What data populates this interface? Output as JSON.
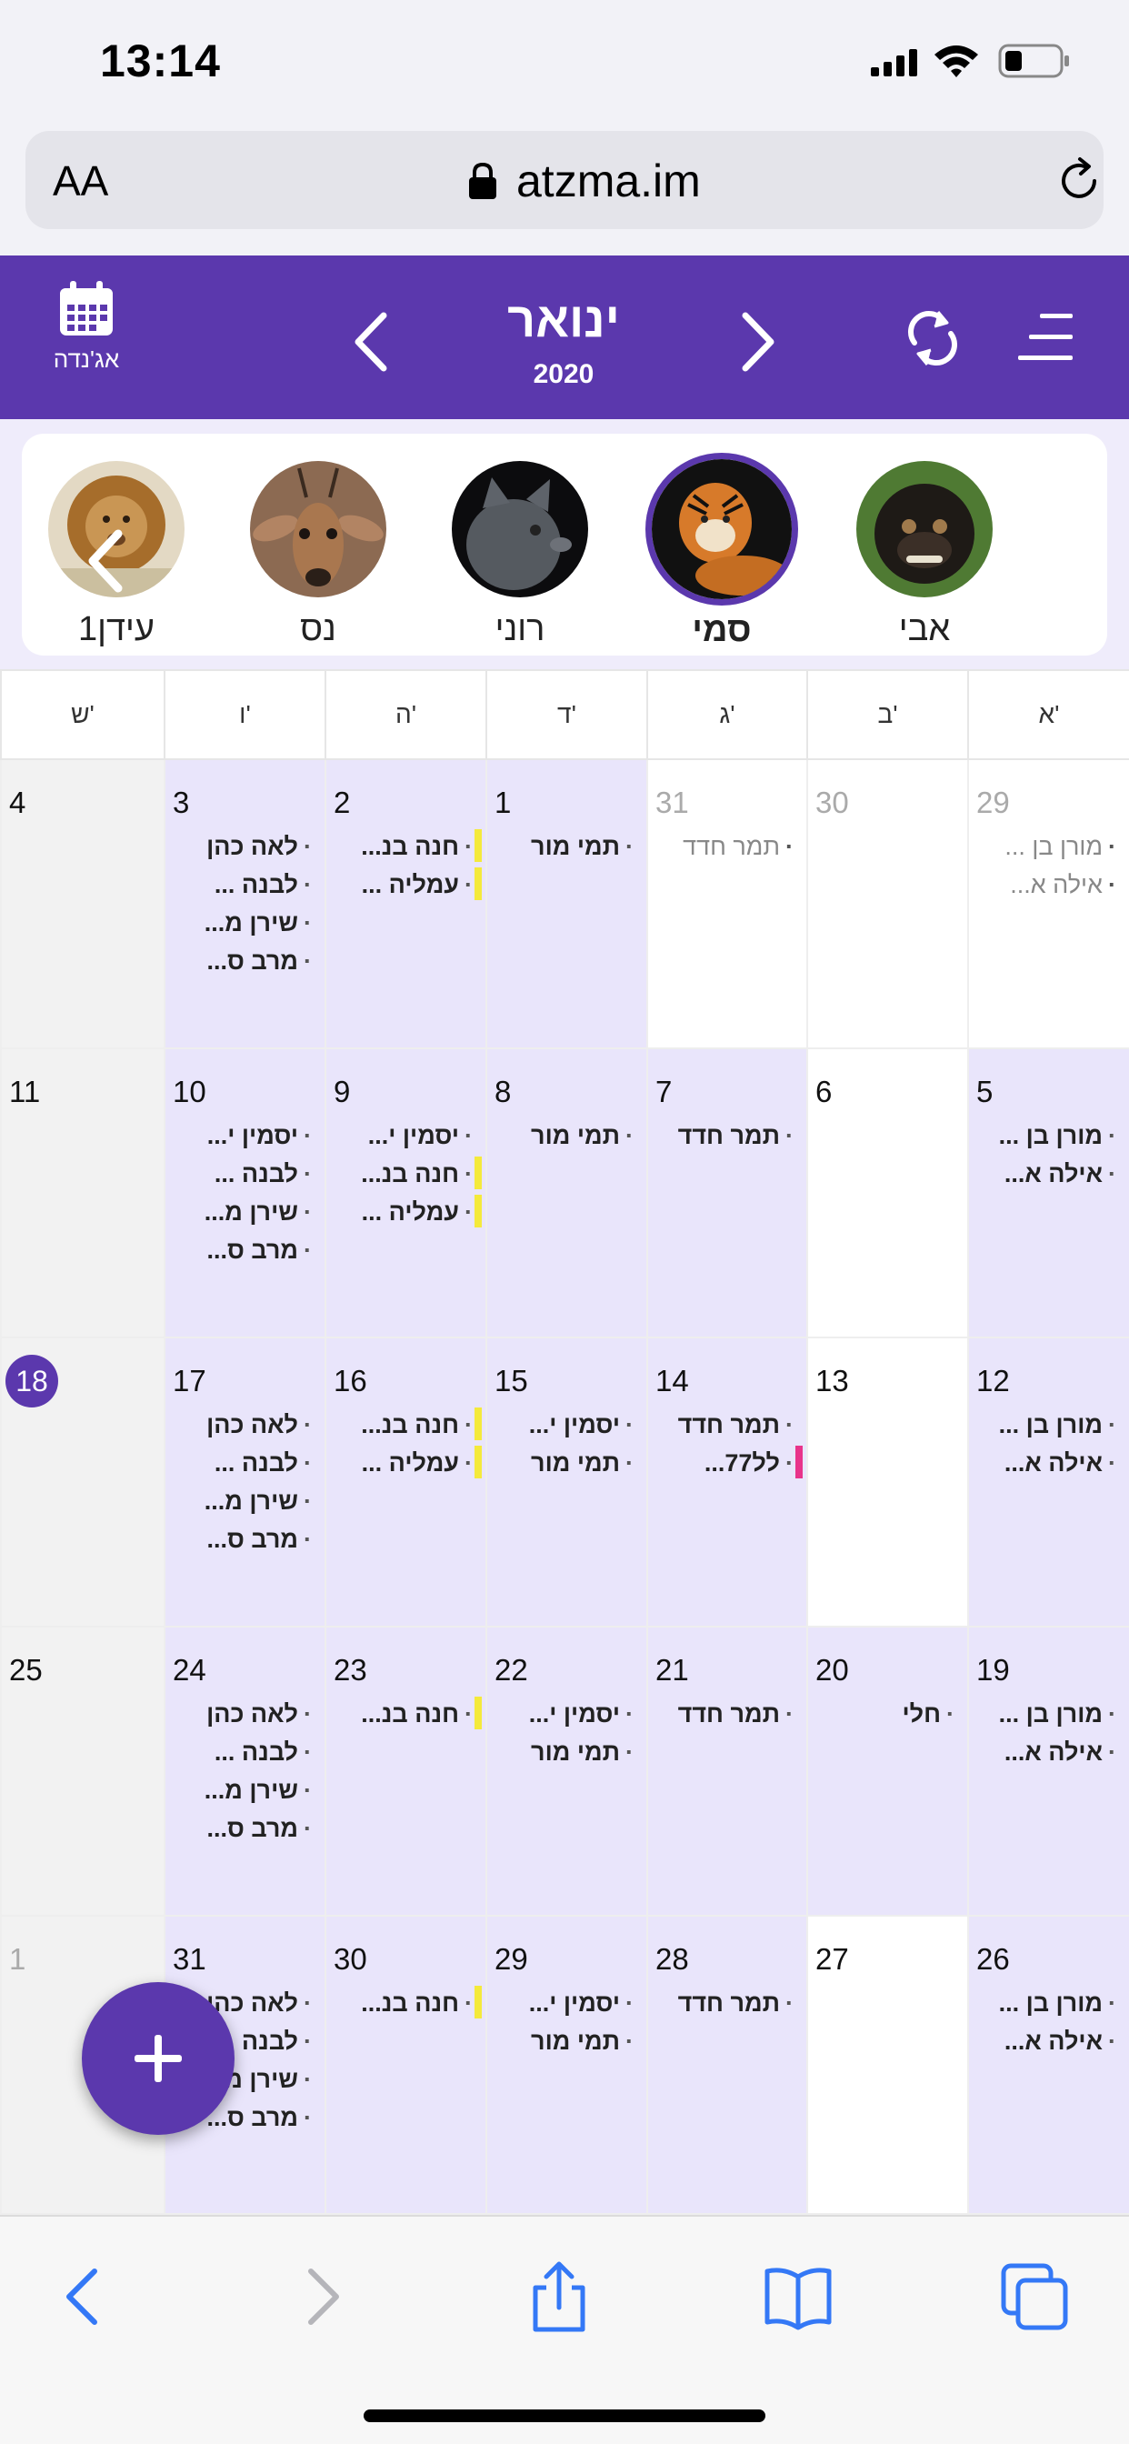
{
  "status_bar": {
    "time": "13:14"
  },
  "browser": {
    "text_size_label": "AA",
    "url": "atzma.im"
  },
  "header": {
    "agenda_label": "אג'נדה",
    "month": "ינואר",
    "year": "2020"
  },
  "profiles": [
    {
      "name": "אבי",
      "selected": false
    },
    {
      "name": "סמי",
      "selected": true
    },
    {
      "name": "רוני",
      "selected": false
    },
    {
      "name": "נס",
      "selected": false
    },
    {
      "name": "עידן1",
      "selected": false
    }
  ],
  "weekdays": [
    "א'",
    "ב'",
    "ג'",
    "ד'",
    "ה'",
    "ו'",
    "ש'"
  ],
  "weeks": [
    [
      {
        "day": "29",
        "muted": true,
        "events": [
          "מורן בן ...",
          "אילה א..."
        ]
      },
      {
        "day": "30",
        "muted": true,
        "events": []
      },
      {
        "day": "31",
        "muted": true,
        "events": [
          "תמר חדד"
        ]
      },
      {
        "day": "1",
        "events": [
          "תמי מור"
        ]
      },
      {
        "day": "2",
        "events": [
          "חנה בנ...",
          "עמליה ..."
        ]
      },
      {
        "day": "3",
        "events": [
          "לאה כהן",
          "לבנה ...",
          "שירן מ...",
          "מרב ס..."
        ]
      },
      {
        "day": "4",
        "events": []
      }
    ],
    [
      {
        "day": "5",
        "events": [
          "מורן בן ...",
          "אילה א..."
        ]
      },
      {
        "day": "6",
        "events": []
      },
      {
        "day": "7",
        "events": [
          "תמר חדד"
        ]
      },
      {
        "day": "8",
        "events": [
          "תמי מור"
        ]
      },
      {
        "day": "9",
        "events": [
          "יסמין י...",
          "חנה בנ...",
          "עמליה ..."
        ]
      },
      {
        "day": "10",
        "events": [
          "יסמין י...",
          "לבנה ...",
          "שירן מ...",
          "מרב ס..."
        ]
      },
      {
        "day": "11",
        "events": []
      }
    ],
    [
      {
        "day": "12",
        "events": [
          "מורן בן ...",
          "אילה א..."
        ]
      },
      {
        "day": "13",
        "events": []
      },
      {
        "day": "14",
        "events": [
          "תמר חדד",
          "לל77..."
        ]
      },
      {
        "day": "15",
        "events": [
          "יסמין י...",
          "תמי מור"
        ]
      },
      {
        "day": "16",
        "events": [
          "חנה בנ...",
          "עמליה ..."
        ]
      },
      {
        "day": "17",
        "events": [
          "לאה כהן",
          "לבנה ...",
          "שירן מ...",
          "מרב ס..."
        ]
      },
      {
        "day": "18",
        "today": true,
        "events": []
      }
    ],
    [
      {
        "day": "19",
        "events": [
          "מורן בן ...",
          "אילה א..."
        ]
      },
      {
        "day": "20",
        "events": [
          "חלי"
        ]
      },
      {
        "day": "21",
        "events": [
          "תמר חדד"
        ]
      },
      {
        "day": "22",
        "events": [
          "יסמין י...",
          "תמי מור"
        ]
      },
      {
        "day": "23",
        "events": [
          "חנה בנ..."
        ]
      },
      {
        "day": "24",
        "events": [
          "לאה כהן",
          "לבנה ...",
          "שירן מ...",
          "מרב ס..."
        ]
      },
      {
        "day": "25",
        "events": []
      }
    ],
    [
      {
        "day": "26",
        "events": [
          "מורן בן ...",
          "אילה א..."
        ]
      },
      {
        "day": "27",
        "events": []
      },
      {
        "day": "28",
        "events": [
          "תמר חדד"
        ]
      },
      {
        "day": "29",
        "events": [
          "יסמין י...",
          "תמי מור"
        ]
      },
      {
        "day": "30",
        "events": [
          "חנה בנ..."
        ]
      },
      {
        "day": "31",
        "events": [
          "לאה כהן",
          "לבנה ...",
          "שירן מ...",
          "מרב ס..."
        ]
      },
      {
        "day": "1",
        "muted": true,
        "events": []
      }
    ]
  ],
  "colors": {
    "brand": "#5b38ad",
    "day_bg": "#e9e5fb",
    "mark_yellow": "#f4ea3b",
    "mark_pink": "#e8338a",
    "link_blue": "#3478f6"
  }
}
